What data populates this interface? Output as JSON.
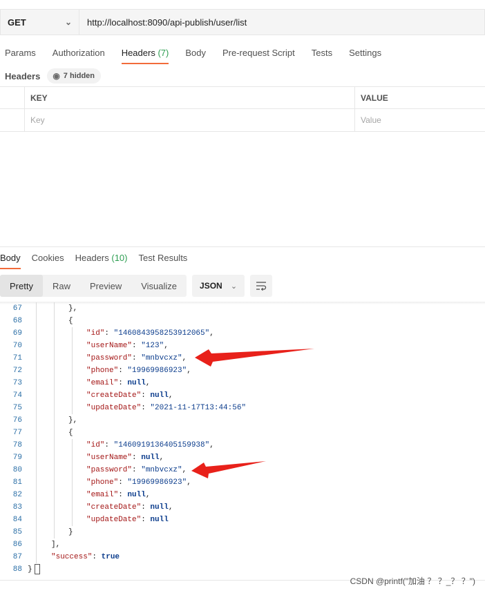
{
  "request": {
    "method": "GET",
    "url": "http://localhost:8090/api-publish/user/list"
  },
  "request_tabs": [
    {
      "label": "Params",
      "count": ""
    },
    {
      "label": "Authorization",
      "count": ""
    },
    {
      "label": "Headers",
      "count": "(7)"
    },
    {
      "label": "Body",
      "count": ""
    },
    {
      "label": "Pre-request Script",
      "count": ""
    },
    {
      "label": "Tests",
      "count": ""
    },
    {
      "label": "Settings",
      "count": ""
    }
  ],
  "headers_section": {
    "label": "Headers",
    "hidden_label": "7 hidden",
    "columns": {
      "key": "KEY",
      "value": "VALUE"
    },
    "placeholders": {
      "key": "Key",
      "value": "Value"
    }
  },
  "response_tabs": [
    {
      "label": "Body",
      "count": ""
    },
    {
      "label": "Cookies",
      "count": ""
    },
    {
      "label": "Headers",
      "count": "(10)"
    },
    {
      "label": "Test Results",
      "count": ""
    }
  ],
  "view_modes": [
    "Pretty",
    "Raw",
    "Preview",
    "Visualize"
  ],
  "format": "JSON",
  "code_lines": [
    {
      "n": "67",
      "indent": 2,
      "tokens": [
        [
          "p",
          "},"
        ]
      ]
    },
    {
      "n": "68",
      "indent": 2,
      "tokens": [
        [
          "p",
          "{"
        ]
      ]
    },
    {
      "n": "69",
      "indent": 3,
      "tokens": [
        [
          "k",
          "\"id\""
        ],
        [
          "p",
          ": "
        ],
        [
          "s",
          "\"1460843958253912065\""
        ],
        [
          "p",
          ","
        ]
      ]
    },
    {
      "n": "70",
      "indent": 3,
      "tokens": [
        [
          "k",
          "\"userName\""
        ],
        [
          "p",
          ": "
        ],
        [
          "s",
          "\"123\""
        ],
        [
          "p",
          ","
        ]
      ]
    },
    {
      "n": "71",
      "indent": 3,
      "tokens": [
        [
          "k",
          "\"password\""
        ],
        [
          "p",
          ": "
        ],
        [
          "s",
          "\"mnbvcxz\""
        ],
        [
          "p",
          ","
        ]
      ]
    },
    {
      "n": "72",
      "indent": 3,
      "tokens": [
        [
          "k",
          "\"phone\""
        ],
        [
          "p",
          ": "
        ],
        [
          "s",
          "\"19969986923\""
        ],
        [
          "p",
          ","
        ]
      ]
    },
    {
      "n": "73",
      "indent": 3,
      "tokens": [
        [
          "k",
          "\"email\""
        ],
        [
          "p",
          ": "
        ],
        [
          "kw",
          "null"
        ],
        [
          "p",
          ","
        ]
      ]
    },
    {
      "n": "74",
      "indent": 3,
      "tokens": [
        [
          "k",
          "\"createDate\""
        ],
        [
          "p",
          ": "
        ],
        [
          "kw",
          "null"
        ],
        [
          "p",
          ","
        ]
      ]
    },
    {
      "n": "75",
      "indent": 3,
      "tokens": [
        [
          "k",
          "\"updateDate\""
        ],
        [
          "p",
          ": "
        ],
        [
          "s",
          "\"2021-11-17T13:44:56\""
        ]
      ]
    },
    {
      "n": "76",
      "indent": 2,
      "tokens": [
        [
          "p",
          "},"
        ]
      ]
    },
    {
      "n": "77",
      "indent": 2,
      "tokens": [
        [
          "p",
          "{"
        ]
      ]
    },
    {
      "n": "78",
      "indent": 3,
      "tokens": [
        [
          "k",
          "\"id\""
        ],
        [
          "p",
          ": "
        ],
        [
          "s",
          "\"1460919136405159938\""
        ],
        [
          "p",
          ","
        ]
      ]
    },
    {
      "n": "79",
      "indent": 3,
      "tokens": [
        [
          "k",
          "\"userName\""
        ],
        [
          "p",
          ": "
        ],
        [
          "kw",
          "null"
        ],
        [
          "p",
          ","
        ]
      ]
    },
    {
      "n": "80",
      "indent": 3,
      "tokens": [
        [
          "k",
          "\"password\""
        ],
        [
          "p",
          ": "
        ],
        [
          "s",
          "\"mnbvcxz\""
        ],
        [
          "p",
          ","
        ]
      ]
    },
    {
      "n": "81",
      "indent": 3,
      "tokens": [
        [
          "k",
          "\"phone\""
        ],
        [
          "p",
          ": "
        ],
        [
          "s",
          "\"19969986923\""
        ],
        [
          "p",
          ","
        ]
      ]
    },
    {
      "n": "82",
      "indent": 3,
      "tokens": [
        [
          "k",
          "\"email\""
        ],
        [
          "p",
          ": "
        ],
        [
          "kw",
          "null"
        ],
        [
          "p",
          ","
        ]
      ]
    },
    {
      "n": "83",
      "indent": 3,
      "tokens": [
        [
          "k",
          "\"createDate\""
        ],
        [
          "p",
          ": "
        ],
        [
          "kw",
          "null"
        ],
        [
          "p",
          ","
        ]
      ]
    },
    {
      "n": "84",
      "indent": 3,
      "tokens": [
        [
          "k",
          "\"updateDate\""
        ],
        [
          "p",
          ": "
        ],
        [
          "kw",
          "null"
        ]
      ]
    },
    {
      "n": "85",
      "indent": 2,
      "tokens": [
        [
          "p",
          "}"
        ]
      ]
    },
    {
      "n": "86",
      "indent": 1,
      "tokens": [
        [
          "p",
          "],"
        ]
      ]
    },
    {
      "n": "87",
      "indent": 1,
      "tokens": [
        [
          "k",
          "\"success\""
        ],
        [
          "p",
          ": "
        ],
        [
          "kw",
          "true"
        ]
      ]
    },
    {
      "n": "88",
      "indent": 0,
      "tokens": [
        [
          "p",
          "}"
        ]
      ]
    }
  ],
  "watermark": "CSDN @printf(\"加油 ？ ？_？ ？\")",
  "colors": {
    "accent": "#f26b3a",
    "count_green": "#2e9e52",
    "annotation_red": "#e8211a"
  }
}
